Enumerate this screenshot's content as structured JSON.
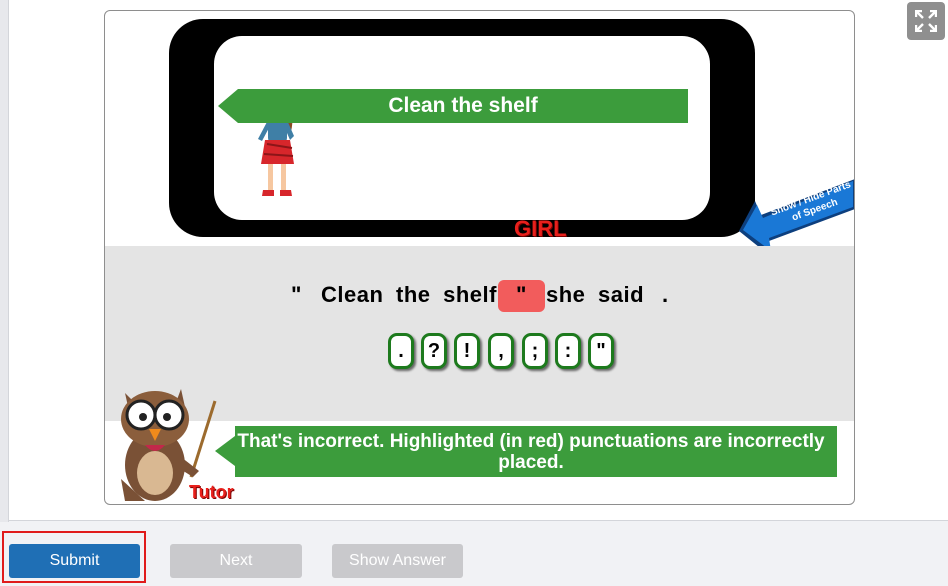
{
  "activity": {
    "picture_label": "GIRL",
    "instruction_arrow_text": "Clean the shelf",
    "parts_of_speech_toggle": "Show / Hide Parts of Speech",
    "sentence": {
      "open_quote": "\"",
      "words": "Clean the shelf",
      "misplaced_mark": "\"",
      "speaker": "she said",
      "end_mark": "."
    },
    "punctuation_options": [
      ".",
      "?",
      "!",
      ",",
      ";",
      ":",
      "\""
    ],
    "tutor_label": "Tutor",
    "feedback": "That's incorrect. Highlighted (in red) punctuations are incorrectly placed."
  },
  "controls": {
    "submit": "Submit",
    "next": "Next",
    "show_answer": "Show Answer"
  },
  "colors": {
    "feedback_green": "#3c9c3c",
    "error_red": "#e8201c",
    "primary_blue": "#1f6fb5",
    "disabled_gray": "#c9c9cc"
  }
}
